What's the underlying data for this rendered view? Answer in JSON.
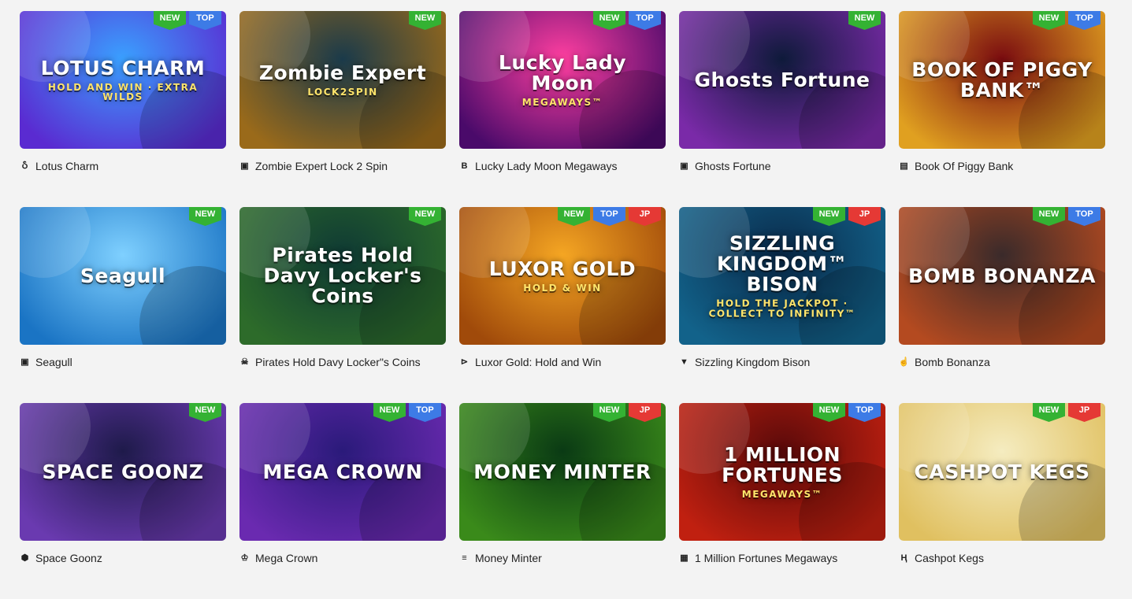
{
  "games": [
    {
      "name": "Lotus Charm",
      "art_title": "LOTUS CHARM",
      "art_sub": "HOLD AND WIN · EXTRA WILDS",
      "badges": [
        "NEW",
        "TOP"
      ],
      "provider_icon": "spiral-icon",
      "glyph": "Ⴢ",
      "bg": [
        "#3aa0ff",
        "#5a2bd1"
      ]
    },
    {
      "name": "Zombie Expert Lock 2 Spin",
      "art_title": "Zombie Expert",
      "art_sub": "LOCK2SPIN",
      "badges": [
        "NEW"
      ],
      "provider_icon": "cube-icon",
      "glyph": "▣",
      "bg": [
        "#1a3a4a",
        "#9a6a1a"
      ]
    },
    {
      "name": "Lucky Lady Moon Megaways",
      "art_title": "Lucky Lady Moon",
      "art_sub": "MEGAWAYS™",
      "badges": [
        "NEW",
        "TOP"
      ],
      "provider_icon": "letter-b-icon",
      "glyph": "B",
      "bg": [
        "#ff3fa0",
        "#4a0a6a"
      ]
    },
    {
      "name": "Ghosts Fortune",
      "art_title": "Ghosts Fortune",
      "art_sub": "",
      "badges": [
        "NEW"
      ],
      "provider_icon": "cube-icon",
      "glyph": "▣",
      "bg": [
        "#0e1a3a",
        "#7a2aa8"
      ]
    },
    {
      "name": "Book Of Piggy Bank",
      "art_title": "BOOK OF PIGGY BANK™",
      "art_sub": "",
      "badges": [
        "NEW",
        "TOP"
      ],
      "provider_icon": "document-icon",
      "glyph": "▤",
      "bg": [
        "#7a0c10",
        "#e0a020"
      ]
    },
    {
      "name": "Seagull",
      "art_title": "Seagull",
      "art_sub": "",
      "badges": [
        "NEW"
      ],
      "provider_icon": "cube-icon",
      "glyph": "▣",
      "bg": [
        "#7fd0ff",
        "#1a74c4"
      ]
    },
    {
      "name": "Pirates Hold Davy Locker\"s Coins",
      "art_title": "Pirates Hold Davy Locker's Coins",
      "art_sub": "",
      "badges": [
        "NEW"
      ],
      "provider_icon": "skull-icon",
      "glyph": "☠",
      "bg": [
        "#0f3a34",
        "#2d6b2a"
      ]
    },
    {
      "name": "Luxor Gold: Hold and Win",
      "art_title": "LUXOR GOLD",
      "art_sub": "HOLD & WIN",
      "badges": [
        "NEW",
        "TOP",
        "JP"
      ],
      "provider_icon": "play-flag-icon",
      "glyph": "⊳",
      "bg": [
        "#f5a623",
        "#a04a0a"
      ]
    },
    {
      "name": "Sizzling Kingdom Bison",
      "art_title": "SIZZLING KINGDOM™ BISON",
      "art_sub": "HOLD THE JACKPOT · COLLECT TO INFINITY™",
      "badges": [
        "NEW",
        "JP"
      ],
      "provider_icon": "chevron-down-icon",
      "glyph": "▼",
      "bg": [
        "#0a2a4a",
        "#12628a"
      ]
    },
    {
      "name": "Bomb Bonanza",
      "art_title": "BOMB BONANZA",
      "art_sub": "",
      "badges": [
        "NEW",
        "TOP"
      ],
      "provider_icon": "hand-icon",
      "glyph": "☝",
      "bg": [
        "#3a2a2a",
        "#b44a20"
      ]
    },
    {
      "name": "Space Goonz",
      "art_title": "SPACE GOONZ",
      "art_sub": "",
      "badges": [
        "NEW"
      ],
      "provider_icon": "hexagon-icon",
      "glyph": "⬢",
      "bg": [
        "#1e1a4a",
        "#6a3ab0"
      ]
    },
    {
      "name": "Mega Crown",
      "art_title": "MEGA CROWN",
      "art_sub": "",
      "badges": [
        "NEW",
        "TOP"
      ],
      "provider_icon": "crown-icon",
      "glyph": "♔",
      "bg": [
        "#2a1a7a",
        "#6a2ab0"
      ]
    },
    {
      "name": "Money Minter",
      "art_title": "MONEY MINTER",
      "art_sub": "",
      "badges": [
        "NEW",
        "JP"
      ],
      "provider_icon": "stripes-icon",
      "glyph": "≡",
      "bg": [
        "#0a3a14",
        "#3a8a1a"
      ]
    },
    {
      "name": "1 Million Fortunes Megaways",
      "art_title": "1 MILLION FORTUNES",
      "art_sub": "MEGAWAYS™",
      "badges": [
        "NEW",
        "TOP"
      ],
      "provider_icon": "grid-icon",
      "glyph": "▦",
      "bg": [
        "#5a0a0a",
        "#c02010"
      ]
    },
    {
      "name": "Cashpot Kegs",
      "art_title": "CASHPOT KEGS",
      "art_sub": "",
      "badges": [
        "NEW",
        "JP"
      ],
      "provider_icon": "h-logo-icon",
      "glyph": "Ⱨ",
      "bg": [
        "#f5ecc0",
        "#e0c060"
      ]
    }
  ],
  "badge_colors": {
    "NEW": "#34b233",
    "TOP": "#3d7be6",
    "JP": "#e53935"
  }
}
